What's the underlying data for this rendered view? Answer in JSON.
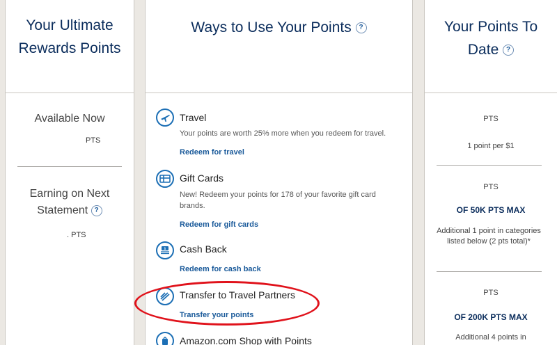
{
  "left": {
    "title_line1": "Your Ultimate",
    "title_line2": "Rewards Points",
    "available_label": "Available Now",
    "available_pts": "PTS",
    "earning_line1": "Earning on Next",
    "earning_line2": "Statement",
    "earning_pts": ". PTS",
    "help_icon": "?"
  },
  "middle": {
    "title": "Ways to Use Your Points",
    "help_icon": "?",
    "items": [
      {
        "title": "Travel",
        "desc": "Your points are worth 25% more when you redeem for travel.",
        "link": "Redeem for travel",
        "icon": "airplane-icon"
      },
      {
        "title": "Gift Cards",
        "desc": "New! Redeem your points for 178 of your favorite gift card brands.",
        "link": "Redeem for gift cards",
        "icon": "gift-card-icon"
      },
      {
        "title": "Cash Back",
        "desc": "",
        "link": "Redeem for cash back",
        "icon": "cash-back-icon"
      },
      {
        "title": "Transfer to Travel Partners",
        "desc": "",
        "link": "Transfer your points",
        "icon": "transfer-icon"
      },
      {
        "title": "Amazon.com Shop with Points",
        "desc": "",
        "link": "",
        "icon": "amazon-icon"
      }
    ]
  },
  "right": {
    "title_line1": "Your Points To",
    "title_line2": "Date",
    "help_icon": "?",
    "block1": {
      "pts": "PTS",
      "desc": "1 point per $1"
    },
    "block2": {
      "pts": "PTS",
      "max": "OF 50K PTS MAX",
      "desc": "Additional 1 point in categories listed below (2 pts total)*"
    },
    "block3": {
      "pts": "PTS",
      "max": "OF 200K PTS MAX",
      "desc": "Additional 4 points in"
    }
  },
  "colors": {
    "navy": "#0b2d5c",
    "link": "#1a5a9a",
    "icon_blue": "#1c6fb5",
    "annotation_red": "#e0121b",
    "background": "#ebe8e3"
  }
}
